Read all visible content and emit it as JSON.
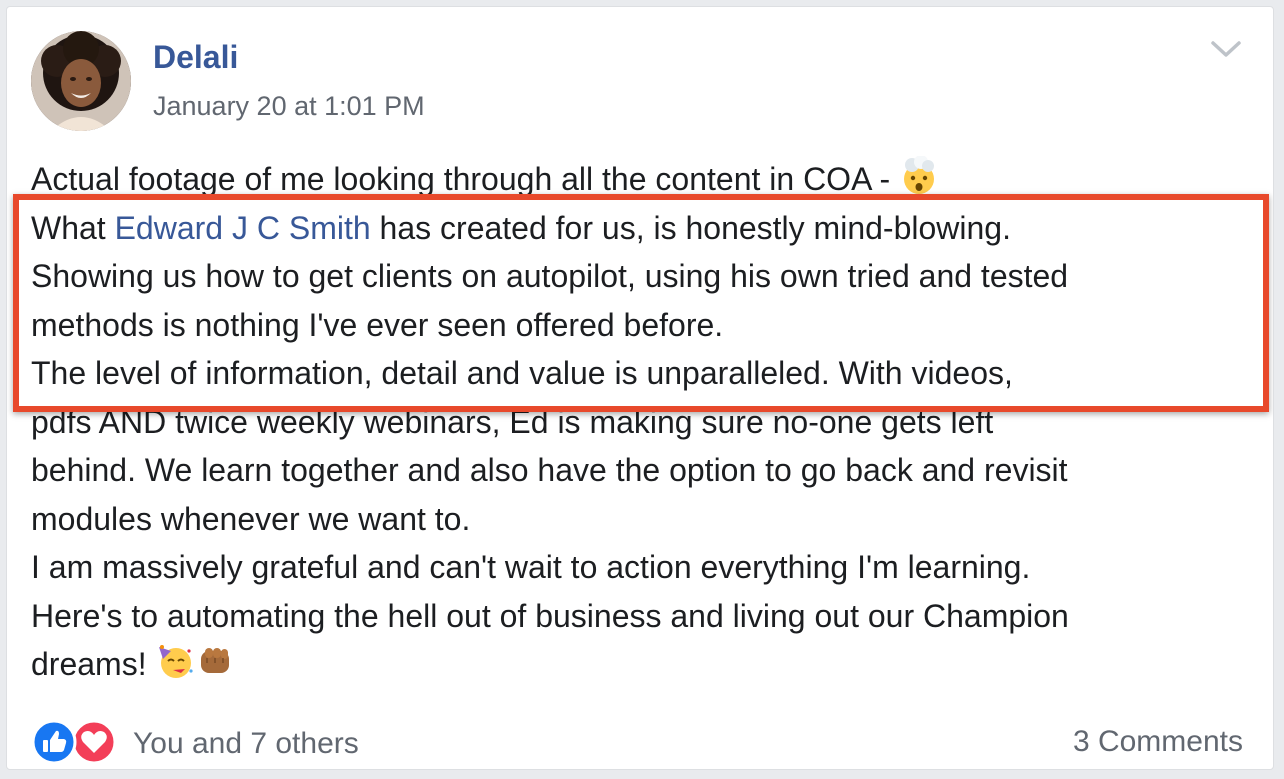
{
  "post": {
    "author": "Delali",
    "timestamp": "January 20 at 1:01 PM",
    "body": {
      "line1": "Actual footage of me looking through all the content in COA - ",
      "line2_pre": "What ",
      "line2_mention": "Edward J C Smith",
      "line2_post": " has created for us, is honestly mind-blowing.",
      "line3": "Showing us how to get clients on autopilot, using his own tried and tested",
      "line4": "methods is nothing I've ever seen offered before.",
      "line5": "The level of information, detail and value is unparalleled. With videos,",
      "line6": "pdfs AND twice weekly webinars, Ed is making sure no-one gets left",
      "line7": "behind. We learn together and also have the option to go back and revisit",
      "line8": "modules whenever we want to.",
      "line9": "I am massively grateful and can't wait to action everything I'm learning.",
      "line10": "Here's to automating the hell out of business and living out our Champion",
      "line11": "dreams! "
    },
    "emojis": [
      "exploding-head-emoji",
      "partying-face-emoji",
      "fist-bump-emoji"
    ]
  },
  "footer": {
    "reactions_text": "You and 7 others",
    "comments_text": "3 Comments"
  },
  "colors": {
    "link": "#385898",
    "text": "#1c1e21",
    "meta": "#616770",
    "highlight": "#e8492b",
    "like_blue": "#1877f2",
    "love_red": "#f33e58"
  }
}
